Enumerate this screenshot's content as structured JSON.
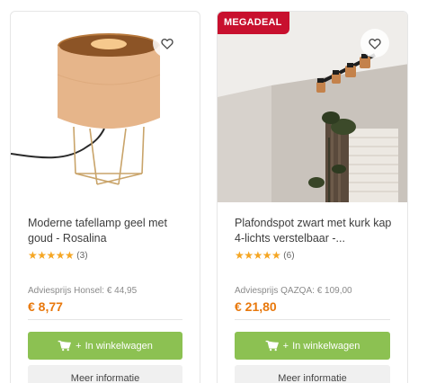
{
  "products": [
    {
      "title": "Moderne tafellamp geel met goud - Rosalina",
      "stars": "★★★★★",
      "review_count": "(3)",
      "advies": "Adviesprijs Honsel: € 44,95",
      "price": "€ 8,77",
      "cart_label": "In winkelwagen",
      "info_label": "Meer informatie",
      "rating": 5
    },
    {
      "badge": "MEGADEAL",
      "title": "Plafondspot zwart met kurk kap 4-lichts verstelbaar -...",
      "stars": "★★★★★",
      "review_count": "(6)",
      "advies": "Adviesprijs QAZQA: € 109,00",
      "price": "€ 21,80",
      "cart_label": "In winkelwagen",
      "info_label": "Meer informatie",
      "rating": 5
    }
  ],
  "colors": {
    "price": "#e8780c",
    "cart_button": "#8cc152",
    "badge": "#c8102e",
    "stars": "#f5a623"
  },
  "icons": {
    "favorite": "heart-outline-icon",
    "cart": "shopping-cart-plus-icon"
  }
}
